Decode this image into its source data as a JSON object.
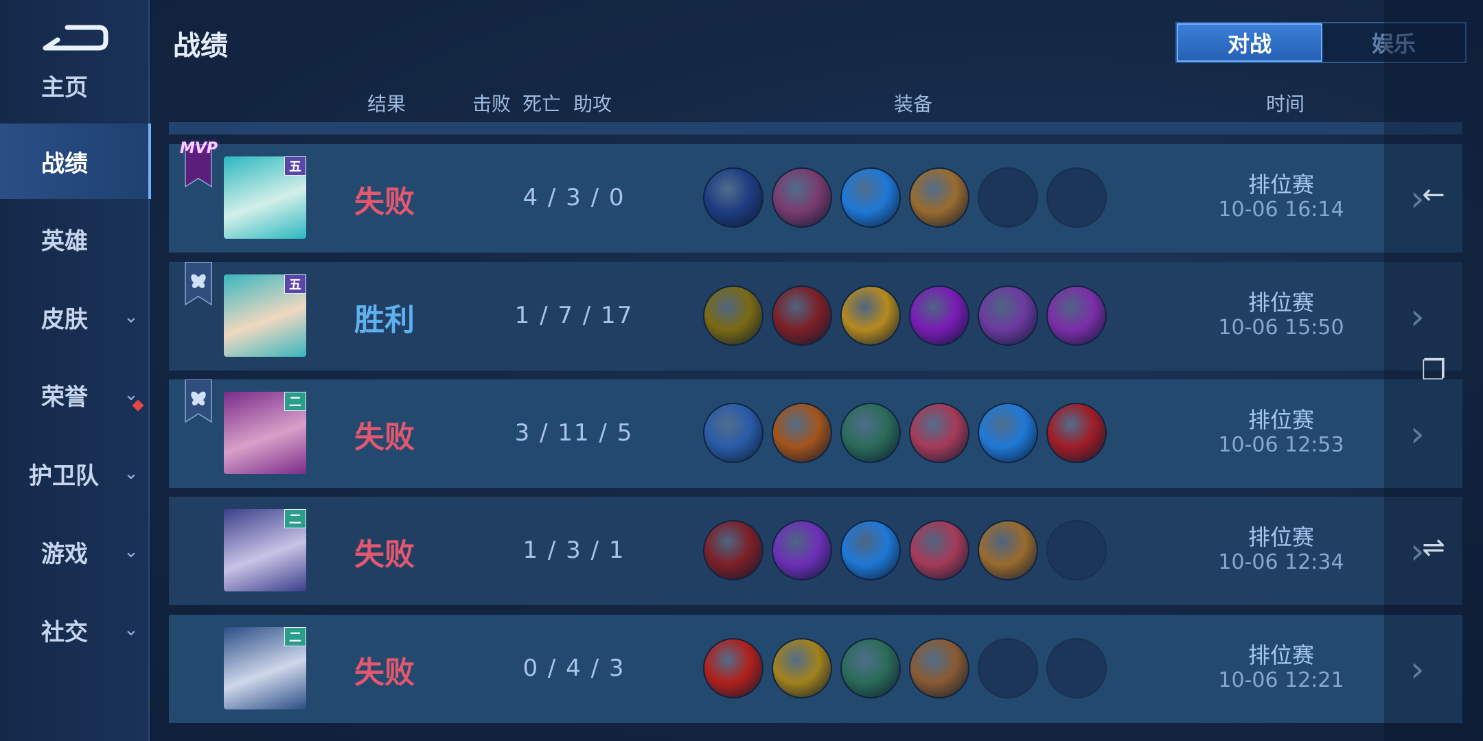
{
  "app": {
    "title": "战绩"
  },
  "sidebar": {
    "items": [
      {
        "label": "主页",
        "active": false,
        "has_chevron": false
      },
      {
        "label": "战绩",
        "active": true,
        "has_chevron": false
      },
      {
        "label": "英雄",
        "active": false,
        "has_chevron": false
      },
      {
        "label": "皮肤",
        "active": false,
        "has_chevron": true
      },
      {
        "label": "荣誉",
        "active": false,
        "has_chevron": true,
        "notification": true
      },
      {
        "label": "护卫队",
        "active": false,
        "has_chevron": true
      },
      {
        "label": "游戏",
        "active": false,
        "has_chevron": true
      },
      {
        "label": "社交",
        "active": false,
        "has_chevron": true
      }
    ]
  },
  "toggle": {
    "active": "对战",
    "inactive": "娱乐"
  },
  "columns": {
    "result": "结果",
    "kills": "击败",
    "deaths": "死亡",
    "assists": "助攻",
    "equipment": "装备",
    "time": "时间"
  },
  "colors": {
    "loss": "#e3576f",
    "win": "#5fb0ef",
    "accent": "#3a7fd8"
  },
  "matches": [
    {
      "mvp": true,
      "badge": "none",
      "rank": "五",
      "result": "失败",
      "outcome": "loss",
      "kda": "4 / 3 / 0",
      "mode": "排位赛",
      "time": "10-06  16:14",
      "hero_colors": [
        "#2ab8c0",
        "#d4efe9"
      ],
      "items": [
        "#1e3d82",
        "#7a3b6e",
        "#1f78d6",
        "#9a6b2e",
        null,
        null
      ]
    },
    {
      "mvp": false,
      "badge": "butterfly",
      "rank": "五",
      "result": "胜利",
      "outcome": "win",
      "kda": "1 / 7 / 17",
      "mode": "排位赛",
      "time": "10-06  15:50",
      "hero_colors": [
        "#39b6bf",
        "#f0d8c0"
      ],
      "items": [
        "#7b6a12",
        "#7d1f26",
        "#b58a1e",
        "#7a1bb5",
        "#6c3aa0",
        "#7c2ea8"
      ]
    },
    {
      "mvp": false,
      "badge": "butterfly",
      "rank": "二",
      "result": "失败",
      "outcome": "loss",
      "kda": "3 / 11 / 5",
      "mode": "排位赛",
      "time": "10-06  12:53",
      "hero_colors": [
        "#7a2c8a",
        "#d8a0c8"
      ],
      "items": [
        "#2a5ba8",
        "#a3541a",
        "#2b6b58",
        "#a63a58",
        "#1f78d6",
        "#a01c25"
      ]
    },
    {
      "mvp": false,
      "badge": "none",
      "rank": "二",
      "result": "失败",
      "outcome": "loss",
      "kda": "1 / 3 / 1",
      "mode": "排位赛",
      "time": "10-06  12:34",
      "hero_colors": [
        "#3b3f8a",
        "#c9c3e6"
      ],
      "items": [
        "#7d1f26",
        "#6d2fb8",
        "#1f78d6",
        "#a63a58",
        "#9a6b2e",
        null
      ]
    },
    {
      "mvp": false,
      "badge": "none",
      "rank": "二",
      "result": "失败",
      "outcome": "loss",
      "kda": "0 / 4 / 3",
      "mode": "排位赛",
      "time": "10-06  12:21",
      "hero_colors": [
        "#2a4e86",
        "#cfd7ea"
      ],
      "items": [
        "#b2201a",
        "#a3821a",
        "#2b6b58",
        "#8a5a32",
        null,
        null
      ]
    }
  ]
}
